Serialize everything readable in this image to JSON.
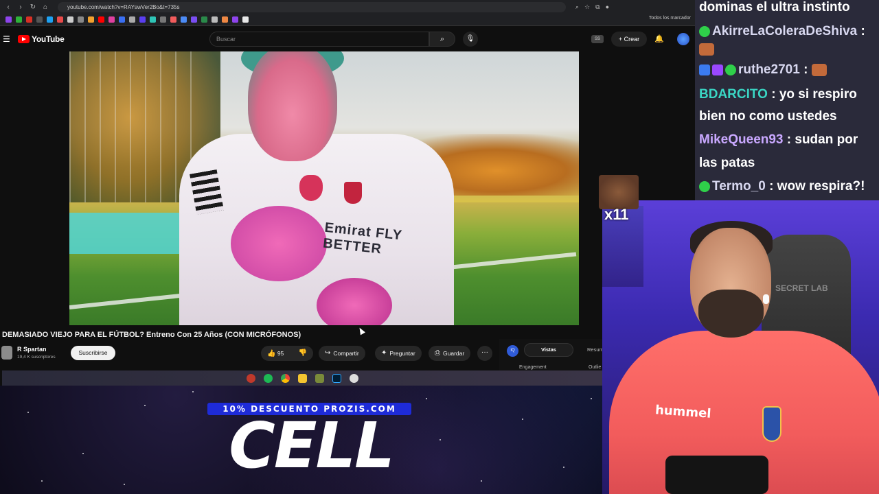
{
  "browser": {
    "url": "youtube.com/watch?v=RAYswVer2Bo&t=735s",
    "bookmarks_label": "Todos los marcador"
  },
  "youtube": {
    "logo_text": "YouTube",
    "search_placeholder": "Buscar",
    "ss_badge": "SS",
    "create_label": "+ Crear"
  },
  "video": {
    "shirt_text": "Emirat FLY BETTER",
    "title": "DEMASIADO VIEJO PARA EL FÚTBOL? Entreno Con 25 Años (CON MICRÓFONOS)",
    "channel_name": "R Spartan",
    "subscribers": "19,4 K suscriptores",
    "subscribe_label": "Suscribirse",
    "likes": "95",
    "share_label": "Compartir",
    "ask_label": "Preguntar",
    "save_label": "Guardar",
    "more_label": "···"
  },
  "extension_panel": {
    "logo": "IQ",
    "tab_active": "Vistas",
    "tab_other": "Resum",
    "metric_left": "Engagement",
    "metric_right": "Outlie"
  },
  "sponsor": {
    "promo": "10% DESCUENTO PROZIS.COM",
    "brand": "CELL"
  },
  "chat": {
    "messages": [
      {
        "user": "",
        "text": "dominas el ultra instinto",
        "user_color": "#ffffff"
      },
      {
        "user": "AkirreLaColeraDeShiva",
        "text": ":",
        "user_color": "#d8d8f0"
      },
      {
        "user": "ruthe2701",
        "text": ":",
        "user_color": "#d8d8f0"
      },
      {
        "user": "BDARCITO",
        "text": ": yo si respiro",
        "user_color": "#3ad6c4"
      },
      {
        "user": "",
        "text": "bien no como ustedes",
        "user_color": "#ffffff"
      },
      {
        "user": "MikeQueen93",
        "text": ": sudan por",
        "user_color": "#c9a8ff"
      },
      {
        "user": "",
        "text": "las patas",
        "user_color": "#ffffff"
      },
      {
        "user": "Termo_0",
        "text": ": wow respira?!",
        "user_color": "#d8d8f0"
      }
    ]
  },
  "overlay": {
    "combo": "x11"
  },
  "cam": {
    "chair_brand": "SECRET LAB",
    "shirt_brand": "hummel"
  }
}
